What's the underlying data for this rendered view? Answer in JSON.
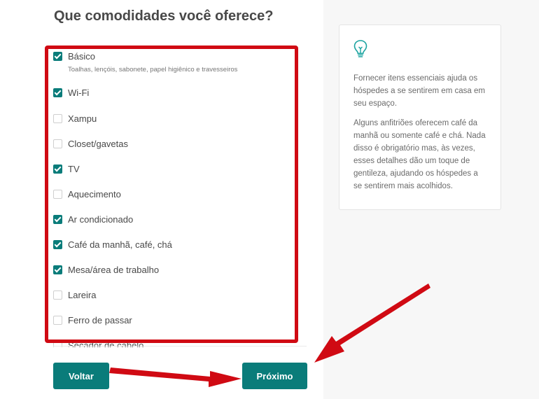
{
  "page": {
    "title": "Que comodidades você oferece?"
  },
  "amenities": [
    {
      "label": "Básico",
      "sub": "Toalhas, lençóis, sabonete, papel higiênico e travesseiros",
      "checked": true
    },
    {
      "label": "Wi-Fi",
      "checked": true
    },
    {
      "label": "Xampu",
      "checked": false
    },
    {
      "label": "Closet/gavetas",
      "checked": false
    },
    {
      "label": "TV",
      "checked": true
    },
    {
      "label": "Aquecimento",
      "checked": false
    },
    {
      "label": "Ar condicionado",
      "checked": true
    },
    {
      "label": "Café da manhã, café, chá",
      "checked": true
    },
    {
      "label": "Mesa/área de trabalho",
      "checked": true
    },
    {
      "label": "Lareira",
      "checked": false
    },
    {
      "label": "Ferro de passar",
      "checked": false
    },
    {
      "label": "Secador de cabelo",
      "checked": false
    }
  ],
  "tip": {
    "icon": "lightbulb-icon",
    "paragraph1": "Fornecer itens essenciais ajuda os hóspedes a se sentirem em casa em seu espaço.",
    "paragraph2": "Alguns anfitriões oferecem café da manhã ou somente café e chá. Nada disso é obrigatório mas, às vezes, esses detalhes dão um toque de gentileza, ajudando os hóspedes a se sentirem mais acolhidos."
  },
  "buttons": {
    "back": "Voltar",
    "next": "Próximo"
  },
  "colors": {
    "accent": "#0a7c7a",
    "annotation": "#d00a13"
  }
}
